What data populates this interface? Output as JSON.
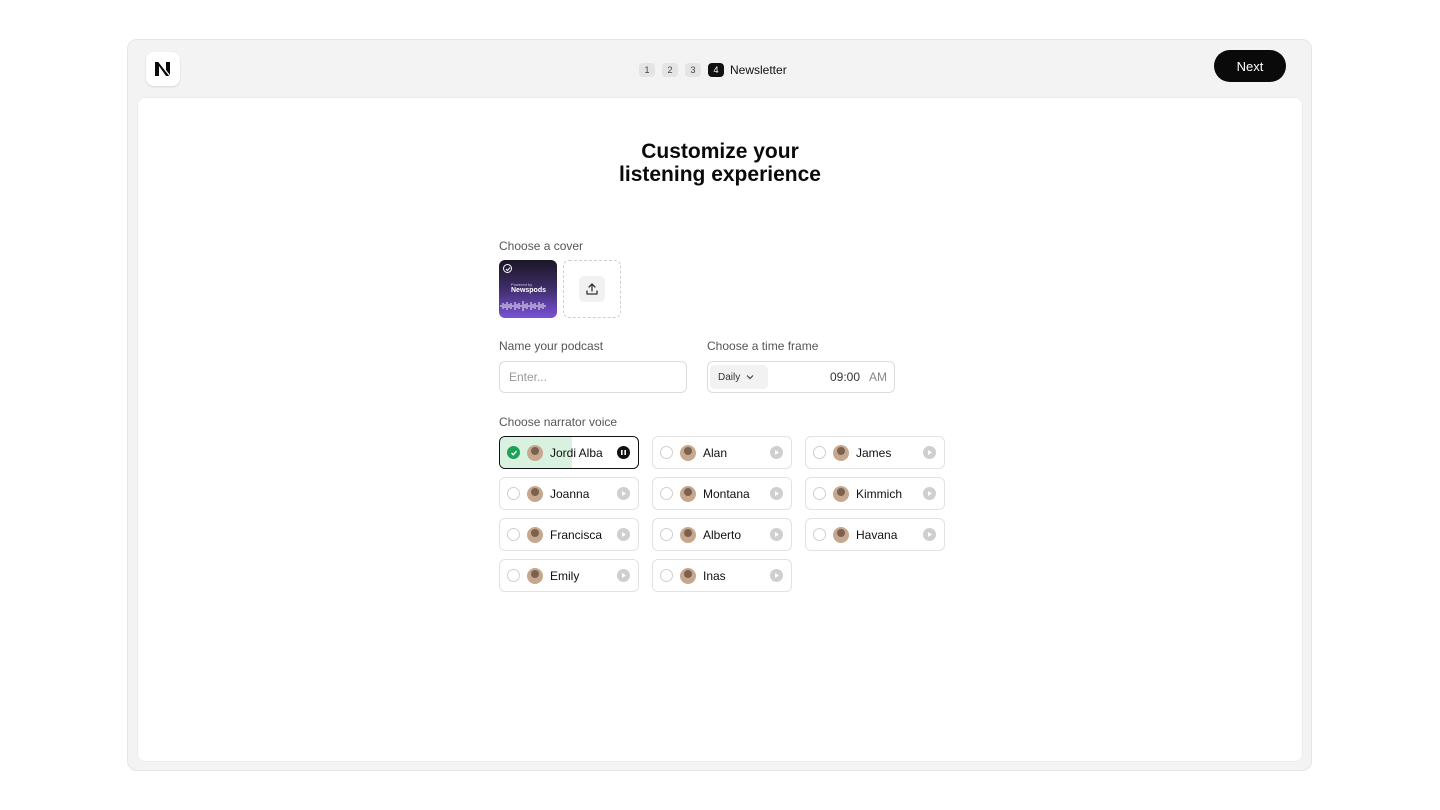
{
  "header": {
    "logo_icon": "newspods-logo-icon",
    "steps": [
      "1",
      "2",
      "3"
    ],
    "active_step": {
      "number": "4",
      "label": "Newsletter"
    },
    "next_label": "Next"
  },
  "main": {
    "title_line1": "Customize your",
    "title_line2": "listening experience",
    "cover": {
      "label": "Choose a cover",
      "selected_small_text": "Powered by",
      "selected_brand": "Newspods",
      "upload_icon": "upload-icon"
    },
    "podcast_name": {
      "label": "Name your podcast",
      "placeholder": "Enter...",
      "value": ""
    },
    "time_frame": {
      "label": "Choose a time frame",
      "frequency": "Daily",
      "time": "09:00",
      "period": "AM"
    },
    "narrator": {
      "label": "Choose narrator voice",
      "voices": [
        {
          "name": "Jordi Alba",
          "selected": true,
          "playing": true,
          "progress": 0.52
        },
        {
          "name": "Alan",
          "selected": false,
          "playing": false
        },
        {
          "name": "James",
          "selected": false,
          "playing": false
        },
        {
          "name": "Joanna",
          "selected": false,
          "playing": false
        },
        {
          "name": "Montana",
          "selected": false,
          "playing": false
        },
        {
          "name": "Kimmich",
          "selected": false,
          "playing": false
        },
        {
          "name": "Francisca",
          "selected": false,
          "playing": false
        },
        {
          "name": "Alberto",
          "selected": false,
          "playing": false
        },
        {
          "name": "Havana",
          "selected": false,
          "playing": false
        },
        {
          "name": "Emily",
          "selected": false,
          "playing": false
        },
        {
          "name": "Inas",
          "selected": false,
          "playing": false
        }
      ]
    }
  },
  "colors": {
    "accent": "#0a0a0a",
    "selected_check": "#1fa159",
    "selected_fill": "#d9f1df",
    "cover_gradient_top": "#1b1726",
    "cover_gradient_bottom": "#7a52d6"
  }
}
